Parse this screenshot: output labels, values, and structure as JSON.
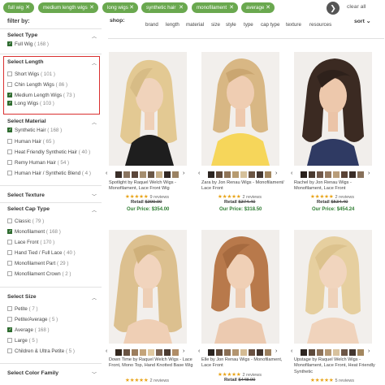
{
  "chips": [
    {
      "label": "full wig"
    },
    {
      "label": "medium length wigs"
    },
    {
      "label": "long wigs"
    },
    {
      "label": "synthetic hair"
    },
    {
      "label": "monofilament"
    },
    {
      "label": "average"
    }
  ],
  "chip_close": "✕",
  "next_arrow": "❯",
  "clear_all": "clear all",
  "sidebar": {
    "filter_by": "filter by:",
    "sections": [
      {
        "title": "Select Type",
        "options": [
          {
            "label": "Full Wig",
            "count": "( 168 )",
            "checked": true
          }
        ]
      },
      {
        "title": "Select Length",
        "options": [
          {
            "label": "Short Wigs",
            "count": "( 101 )",
            "checked": false
          },
          {
            "label": "Chin Length Wigs",
            "count": "( 86 )",
            "checked": false
          },
          {
            "label": "Medium Length Wigs",
            "count": "( 73 )",
            "checked": true
          },
          {
            "label": "Long Wigs",
            "count": "( 103 )",
            "checked": true
          }
        ]
      },
      {
        "title": "Select Material",
        "options": [
          {
            "label": "Synthetic Hair",
            "count": "( 168 )",
            "checked": true
          },
          {
            "label": "Human Hair",
            "count": "( 65 )",
            "checked": false
          },
          {
            "label": "Heat Friendly Synthetic Hair",
            "count": "( 40 )",
            "checked": false
          },
          {
            "label": "Remy Human Hair",
            "count": "( 54 )",
            "checked": false
          },
          {
            "label": "Human Hair / Synthetic Blend",
            "count": "( 4 )",
            "checked": false
          }
        ]
      },
      {
        "title": "Select Texture",
        "options": []
      },
      {
        "title": "Select Cap Type",
        "options": [
          {
            "label": "Classic",
            "count": "( 79 )",
            "checked": false
          },
          {
            "label": "Monofilament",
            "count": "( 168 )",
            "checked": true
          },
          {
            "label": "Lace Front",
            "count": "( 170 )",
            "checked": false
          },
          {
            "label": "Hand Tied / Full Lace",
            "count": "( 40 )",
            "checked": false
          },
          {
            "label": "Monofilament Part",
            "count": "( 29 )",
            "checked": false
          },
          {
            "label": "Monofilament Crown",
            "count": "( 2 )",
            "checked": false
          }
        ]
      },
      {
        "title": "Select Size",
        "options": [
          {
            "label": "Petite",
            "count": "( 7 )",
            "checked": false
          },
          {
            "label": "Petite/Average",
            "count": "( 5 )",
            "checked": false
          },
          {
            "label": "Average",
            "count": "( 168 )",
            "checked": true
          },
          {
            "label": "Large",
            "count": "( 5 )",
            "checked": false
          },
          {
            "label": "Children & Ultra Petite",
            "count": "( 5 )",
            "checked": false
          }
        ]
      },
      {
        "title": "Select Color Family",
        "options": []
      }
    ]
  },
  "shop": {
    "label": "shop:",
    "tabs": [
      "brand",
      "length",
      "material",
      "size",
      "style",
      "type",
      "cap type",
      "texture",
      "resources"
    ],
    "sort_label": "sort ⌄"
  },
  "products": [
    {
      "name": "Spotlight by Raquel Welch Wigs - Monofilament, Lace Front Wig",
      "rating": "★★★★★",
      "reviews": "9 reviews",
      "retail_label": "Retail",
      "retail": "$399.00",
      "our_label": "Our Price:",
      "our_price": "$354.00",
      "swatches": [
        "#3a2e28",
        "#8a7560",
        "#5b463a",
        "#a58e6f",
        "#6b5848",
        "#c7b08a",
        "#322824",
        "#9a8263"
      ]
    },
    {
      "name": "Zara by Jon Renau Wigs - Monofilament/ Lace Front",
      "rating": "★★★★★",
      "reviews": "2 reviews",
      "retail_label": "Retail",
      "retail": "$374.40",
      "our_label": "Our Price:",
      "our_price": "$318.50",
      "swatches": [
        "#2c2521",
        "#5f4a3b",
        "#8f7457",
        "#b79b70",
        "#d6c19b",
        "#6b5544",
        "#453832",
        "#a2865f"
      ]
    },
    {
      "name": "Rachel by Jon Renau Wigs - Monofilament, Lace Front",
      "rating": "★★★★★",
      "reviews": "2 reviews",
      "retail_label": "Retail",
      "retail": "$534.40",
      "our_label": "Our Price:",
      "our_price": "$454.24",
      "swatches": [
        "#2a211d",
        "#4a3a30",
        "#70584a",
        "#94785f",
        "#b99d7a",
        "#5a4336",
        "#3a2d27",
        "#87705a"
      ]
    },
    {
      "name": "Down Time by Raquel Welch Wigs - Lace Front, Mono Top, Hand Knotted Base Wig",
      "rating": "★★★★★",
      "reviews": "2 reviews",
      "retail_label": "Retail",
      "retail": "",
      "our_label": "",
      "our_price": "",
      "swatches": [
        "#35291f",
        "#6a5443",
        "#9c7e5e",
        "#c4a47a",
        "#e0c9a1",
        "#7a6250",
        "#4b3b31",
        "#b08d67"
      ]
    },
    {
      "name": "Elle by Jon Renau Wigs - Monofilament, Lace Front",
      "rating": "★★★★★",
      "reviews": "2 reviews",
      "retail_label": "Retail",
      "retail": "$448.00",
      "our_label": "",
      "our_price": "",
      "swatches": [
        "#2b2420",
        "#5c4738",
        "#8a6e54",
        "#b39570",
        "#d4bb93",
        "#6a5242",
        "#41342d",
        "#9c805f"
      ]
    },
    {
      "name": "Upstage by Raquel Welch Wigs - Monofilament, Lace Front, Heat Friendly Synthetic",
      "rating": "★★★★★",
      "reviews": "5 reviews",
      "retail_label": "",
      "retail": "",
      "our_label": "",
      "our_price": "",
      "swatches": [
        "#2d2520",
        "#5e4a3c",
        "#8d7259",
        "#b59874",
        "#d8c29e",
        "#6d5646",
        "#443730",
        "#a3875f"
      ]
    }
  ],
  "colors": {
    "chip": "#6aa84f",
    "accent_green": "#2e7d32",
    "highlight": "#d93030",
    "star": "#e8a317"
  }
}
